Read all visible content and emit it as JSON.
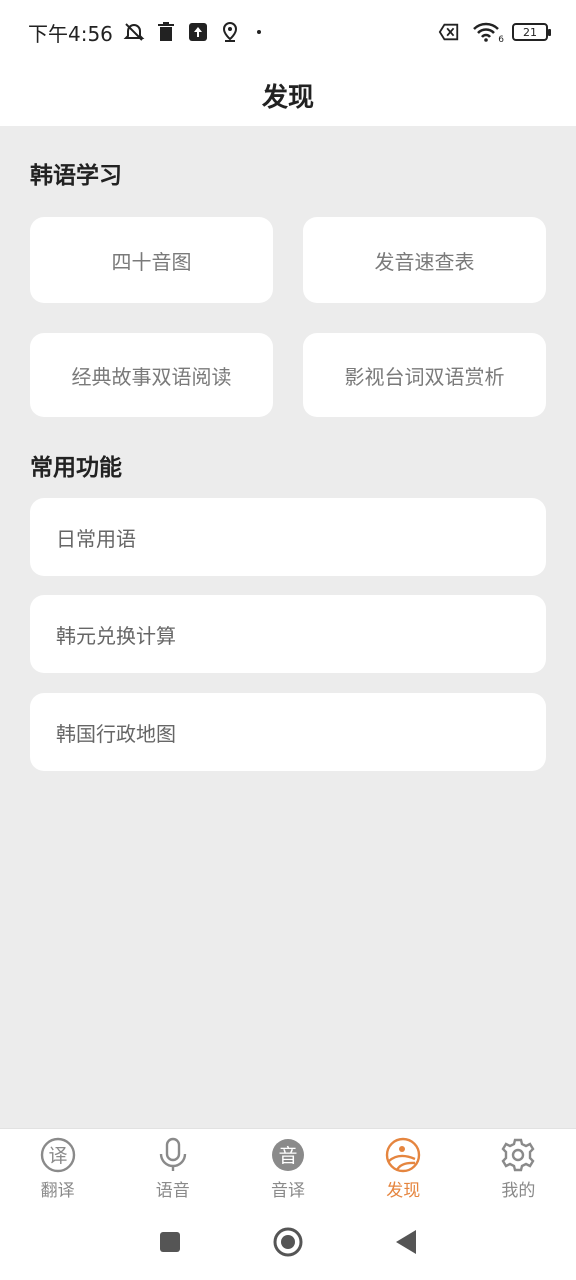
{
  "status": {
    "time": "下午4:56",
    "battery": "21",
    "wifi_sub": "6"
  },
  "header": {
    "title": "发现"
  },
  "korean_learning": {
    "title": "韩语学习",
    "cards": [
      "四十音图",
      "发音速查表",
      "经典故事双语阅读",
      "影视台词双语赏析"
    ]
  },
  "common_functions": {
    "title": "常用功能",
    "items": [
      "日常用语",
      "韩元兑换计算",
      "韩国行政地图"
    ]
  },
  "tabs": [
    {
      "label": "翻译",
      "icon": "translate-icon",
      "glyph": "译"
    },
    {
      "label": "语音",
      "icon": "microphone-icon"
    },
    {
      "label": "音译",
      "icon": "transliterate-icon",
      "glyph": "音"
    },
    {
      "label": "发现",
      "icon": "discover-icon",
      "active": true
    },
    {
      "label": "我的",
      "icon": "gear-icon"
    }
  ],
  "colors": {
    "accent": "#e5853f",
    "background": "#ececec",
    "card": "#ffffff",
    "inactive": "#8a8a8a"
  }
}
